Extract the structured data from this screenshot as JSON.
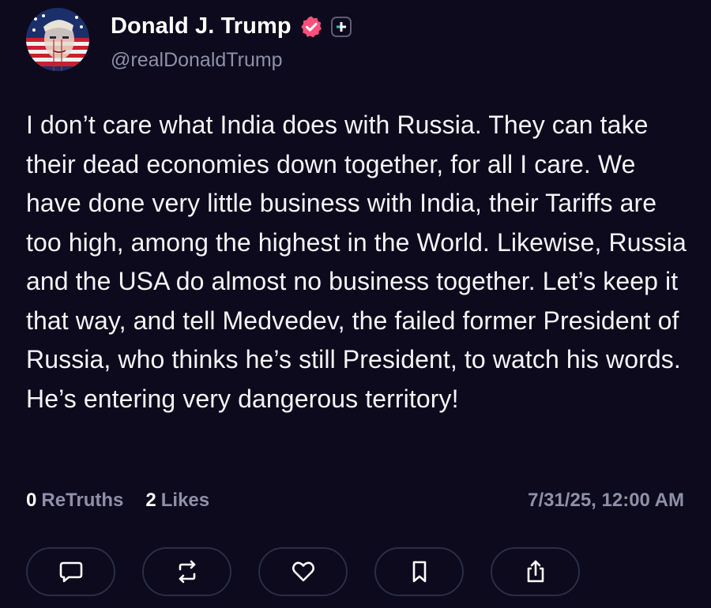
{
  "author": {
    "display_name": "Donald J. Trump",
    "handle": "@realDonaldTrump",
    "verified_icon": "verified-badge-icon",
    "plus_icon": "plus-icon",
    "verified_color": "#ff4f7c"
  },
  "post": {
    "text": "I don’t care what India does with Russia. They can take their dead economies down together, for all I care. We have done very little business with India, their Tariffs are too high, among the highest in the World. Likewise, Russia and the USA do almost no business together. Let’s keep it that way, and tell Medvedev, the failed former President of Russia, who thinks he’s still President, to watch his words. He’s entering very dangerous territory!"
  },
  "stats": {
    "retruths_count": "0",
    "retruths_label": "ReTruths",
    "likes_count": "2",
    "likes_label": "Likes",
    "timestamp": "7/31/25, 12:00 AM"
  },
  "actions": [
    {
      "name": "reply",
      "icon": "comment-icon"
    },
    {
      "name": "retruth",
      "icon": "repost-icon"
    },
    {
      "name": "like",
      "icon": "heart-icon"
    },
    {
      "name": "bookmark",
      "icon": "bookmark-icon"
    },
    {
      "name": "share",
      "icon": "share-icon"
    }
  ],
  "colors": {
    "background": "#0c0a1c",
    "muted_text": "#8f90a8",
    "button_border": "#2c2d44"
  }
}
